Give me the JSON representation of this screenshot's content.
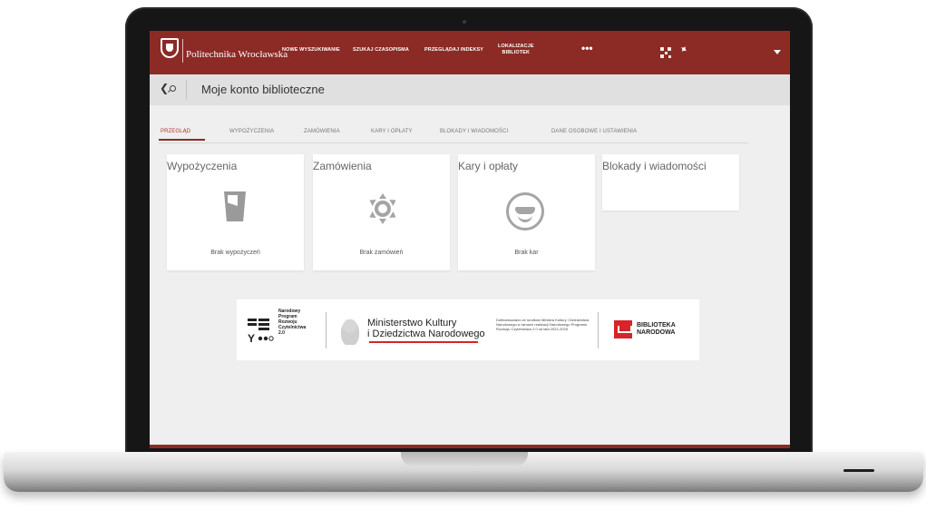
{
  "header": {
    "brand": "Politechnika Wrocławska",
    "nav": [
      {
        "line1": "NOWE WYSZUKIWANIE",
        "line2": ""
      },
      {
        "line1": "SZUKAJ CZASOPISMA",
        "line2": ""
      },
      {
        "line1": "PRZEGLĄDAJ INDEKSY",
        "line2": ""
      },
      {
        "line1": "LOKALIZACJE",
        "line2": "BIBLIOTEK"
      }
    ],
    "more": "•••"
  },
  "titlebar": {
    "back": "❮",
    "title": "Moje konto biblioteczne"
  },
  "tabs": [
    {
      "label": "PRZEGLĄD",
      "active": true
    },
    {
      "label": "WYPOŻYCZENIA"
    },
    {
      "label": "ZAMÓWIENIA"
    },
    {
      "label": "KARY I OPŁATY"
    },
    {
      "label": "BLOKADY I WIADOMOŚCI"
    },
    {
      "label": "DANE OSOBOWE I USTAWIENIA"
    }
  ],
  "cards": [
    {
      "title": "Wypożyczenia",
      "empty": "Brak wypożyczeń",
      "icon": "cup-icon"
    },
    {
      "title": "Zamówienia",
      "empty": "Brak zamówień",
      "icon": "gear-icon"
    },
    {
      "title": "Kary i opłaty",
      "empty": "Brak kar",
      "icon": "smiley-icon"
    },
    {
      "title": "Blokady i wiadomości",
      "empty": ""
    }
  ],
  "banner": {
    "nprcz": [
      "Narodowy",
      "Program",
      "Rozwoju",
      "Czytelnictwa",
      "2.0"
    ],
    "mkidn": [
      "Ministerstwo Kultury",
      "i Dziedzictwa Narodowego"
    ],
    "funding": "Dofinansowano ze środków Ministra Kultury i Dziedzictwa Narodowego w ramach realizacji Narodowego Programu Rozwoju Czytelnictwa 2.0 na lata 2021-2025",
    "bn": [
      "BIBLIOTEKA",
      "NARODOWA"
    ]
  },
  "colors": {
    "brand": "#8c2a25",
    "tab_active": "#b03a34",
    "accent_red": "#d8232a"
  }
}
